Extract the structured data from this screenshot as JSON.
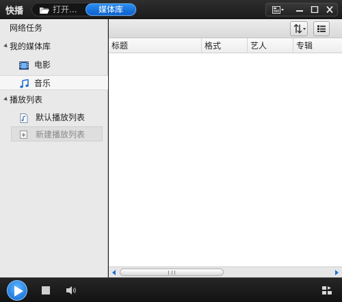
{
  "app": {
    "title": "快播"
  },
  "titlebar": {
    "tabs": [
      {
        "label": "打开..."
      },
      {
        "label": "媒体库",
        "active": true
      }
    ]
  },
  "sidebar": {
    "items": [
      {
        "label": "网络任务"
      },
      {
        "label": "我的媒体库"
      },
      {
        "label": "电影"
      },
      {
        "label": "音乐",
        "selected": true
      },
      {
        "label": "播放列表"
      },
      {
        "label": "默认播放列表"
      },
      {
        "label": "新建播放列表",
        "disabled": true
      }
    ]
  },
  "table": {
    "columns": [
      "标题",
      "格式",
      "艺人",
      "专辑"
    ],
    "rows": []
  },
  "colors": {
    "accent": "#1a7fe8",
    "titlebar_bg": "#1b1b1b",
    "sidebar_bg": "#e9e9e9",
    "content_bg": "#ffffff",
    "control_bg": "#121212"
  },
  "icons": {
    "open": "folder-open-icon",
    "layout": "layout-menu-icon",
    "minimize": "minimize-icon",
    "maximize": "maximize-icon",
    "close": "close-icon",
    "movie": "film-icon",
    "music": "music-note-icon",
    "playlist": "playlist-file-icon",
    "new_playlist": "add-playlist-icon",
    "sort": "sort-icon",
    "view": "list-view-icon",
    "play": "play-icon",
    "stop": "stop-icon",
    "volume": "speaker-icon",
    "mode": "playlist-mode-icon"
  }
}
